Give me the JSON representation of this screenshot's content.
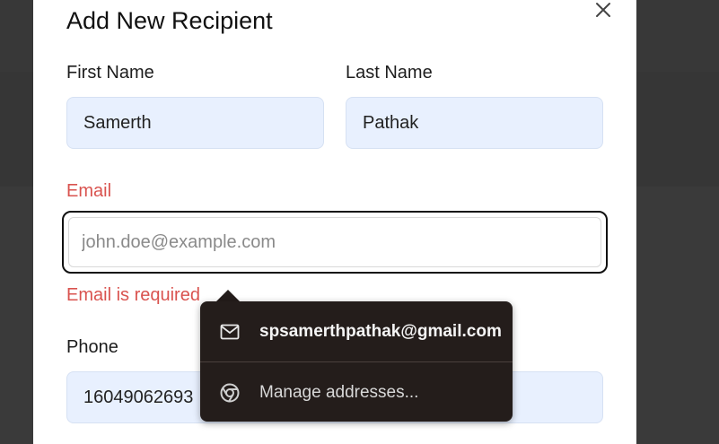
{
  "dialog": {
    "title": "Add New Recipient",
    "close_icon": "close-icon"
  },
  "form": {
    "first_name": {
      "label": "First Name",
      "value": "Samerth"
    },
    "last_name": {
      "label": "Last Name",
      "value": "Pathak"
    },
    "email": {
      "label": "Email",
      "value": "",
      "placeholder": "john.doe@example.com",
      "error": "Email is required"
    },
    "phone": {
      "label": "Phone",
      "value": "16049062693"
    }
  },
  "autofill": {
    "suggestion": {
      "icon": "mail-icon",
      "text": "spsamerthpathak@gmail.com"
    },
    "manage": {
      "icon": "chrome-icon",
      "text": "Manage addresses..."
    }
  },
  "colors": {
    "error": "#d9534f",
    "field_bg": "#e8f0fe",
    "popup_bg": "#241d1b",
    "backdrop": "#3a3a3a"
  }
}
